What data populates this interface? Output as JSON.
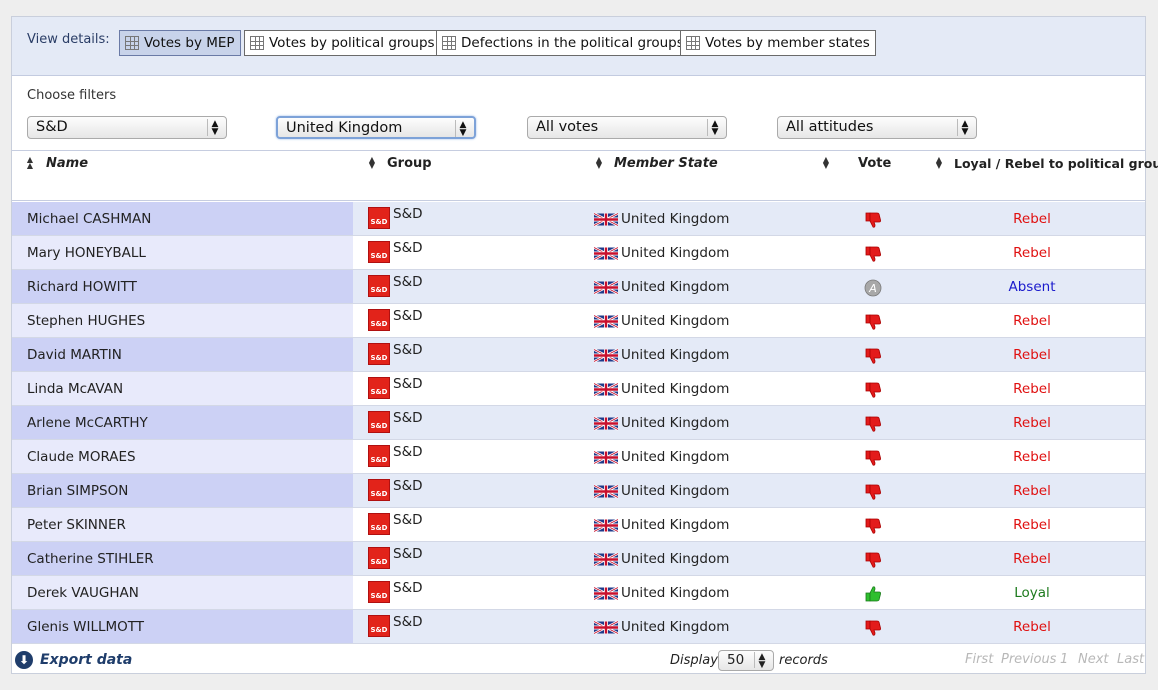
{
  "details": {
    "label": "View details:",
    "buttons": [
      {
        "label": "Votes by MEP",
        "active": true
      },
      {
        "label": "Votes by political groups",
        "active": false
      },
      {
        "label": "Defections in the political groups",
        "active": false
      },
      {
        "label": "Votes by member states",
        "active": false
      }
    ]
  },
  "filters": {
    "label": "Choose filters",
    "group": "S&D",
    "member_state": "United Kingdom",
    "votes": "All votes",
    "attitudes": "All attitudes"
  },
  "table": {
    "columns": {
      "name": "Name",
      "group": "Group",
      "member_state": "Member State",
      "vote": "Vote",
      "attitude": "Loyal / Rebel to political group"
    },
    "rows": [
      {
        "name": "Michael CASHMAN",
        "group": "S&D",
        "state": "United Kingdom",
        "vote": "against",
        "attitude": "Rebel"
      },
      {
        "name": "Mary HONEYBALL",
        "group": "S&D",
        "state": "United Kingdom",
        "vote": "against",
        "attitude": "Rebel"
      },
      {
        "name": "Richard HOWITT",
        "group": "S&D",
        "state": "United Kingdom",
        "vote": "absent",
        "attitude": "Absent"
      },
      {
        "name": "Stephen HUGHES",
        "group": "S&D",
        "state": "United Kingdom",
        "vote": "against",
        "attitude": "Rebel"
      },
      {
        "name": "David MARTIN",
        "group": "S&D",
        "state": "United Kingdom",
        "vote": "against",
        "attitude": "Rebel"
      },
      {
        "name": "Linda McAVAN",
        "group": "S&D",
        "state": "United Kingdom",
        "vote": "against",
        "attitude": "Rebel"
      },
      {
        "name": "Arlene McCARTHY",
        "group": "S&D",
        "state": "United Kingdom",
        "vote": "against",
        "attitude": "Rebel"
      },
      {
        "name": "Claude MORAES",
        "group": "S&D",
        "state": "United Kingdom",
        "vote": "against",
        "attitude": "Rebel"
      },
      {
        "name": "Brian SIMPSON",
        "group": "S&D",
        "state": "United Kingdom",
        "vote": "against",
        "attitude": "Rebel"
      },
      {
        "name": "Peter SKINNER",
        "group": "S&D",
        "state": "United Kingdom",
        "vote": "against",
        "attitude": "Rebel"
      },
      {
        "name": "Catherine STIHLER",
        "group": "S&D",
        "state": "United Kingdom",
        "vote": "against",
        "attitude": "Rebel"
      },
      {
        "name": "Derek VAUGHAN",
        "group": "S&D",
        "state": "United Kingdom",
        "vote": "for",
        "attitude": "Loyal"
      },
      {
        "name": "Glenis WILLMOTT",
        "group": "S&D",
        "state": "United Kingdom",
        "vote": "against",
        "attitude": "Rebel"
      }
    ]
  },
  "group_logo_text": "S&D",
  "absent_icon_letter": "A",
  "footer": {
    "export_label": "Export data",
    "display_label": "Display",
    "display_value": "50",
    "records_label": "records",
    "pager": {
      "first": "First",
      "previous": "Previous",
      "page": "1",
      "next": "Next",
      "last": "Last"
    }
  },
  "colors": {
    "rebel": "#e01010",
    "absent": "#1a1acc",
    "loyal": "#1d7a1d",
    "vote_against": "#e31b1b",
    "vote_for": "#2fbf2f",
    "vote_absent": "#a8a8a8"
  },
  "icons": {
    "vote_against": "thumbs-down-icon",
    "vote_for": "thumbs-up-icon",
    "vote_absent": "absent-circle-icon",
    "export": "download-arrow-icon",
    "flag": "uk-flag-icon",
    "group_logo": "sd-group-logo-icon"
  }
}
